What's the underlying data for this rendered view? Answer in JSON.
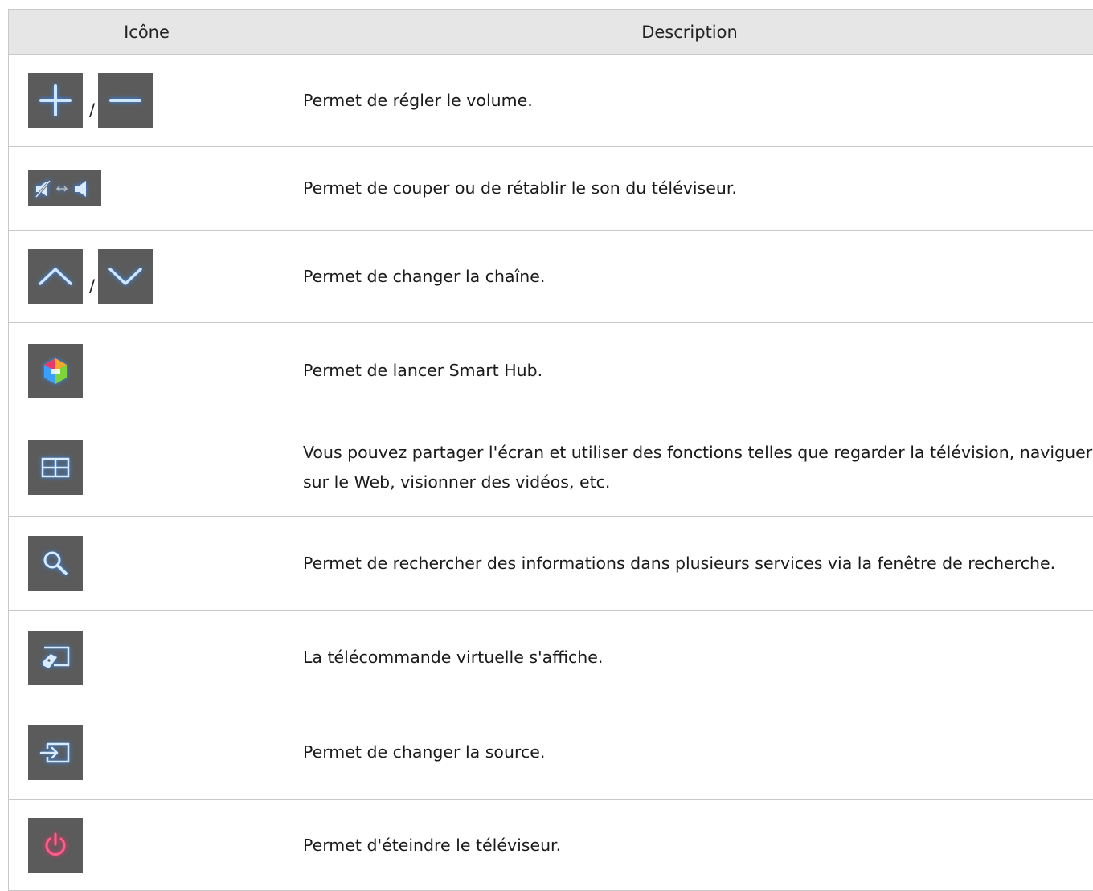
{
  "table": {
    "headers": {
      "icon": "Icône",
      "description": "Description"
    },
    "separator": "/",
    "rows": [
      {
        "icons": [
          "plus-icon",
          "minus-icon"
        ],
        "description": "Permet de régler le volume."
      },
      {
        "icons": [
          "mute-toggle-icon"
        ],
        "description": "Permet de couper ou de rétablir le son du téléviseur."
      },
      {
        "icons": [
          "chevron-up-icon",
          "chevron-down-icon"
        ],
        "description": "Permet de changer la chaîne."
      },
      {
        "icons": [
          "smart-hub-icon"
        ],
        "description": "Permet de lancer Smart Hub."
      },
      {
        "icons": [
          "multi-screen-icon"
        ],
        "description": "Vous pouvez partager l'écran et utiliser des fonctions telles que regarder la télévision, naviguer sur le Web, visionner des vidéos, etc."
      },
      {
        "icons": [
          "search-icon"
        ],
        "description": "Permet de rechercher des informations dans plusieurs services via la fenêtre de recherche."
      },
      {
        "icons": [
          "virtual-remote-icon"
        ],
        "description": "La télécommande virtuelle s'affiche."
      },
      {
        "icons": [
          "source-icon"
        ],
        "description": "Permet de changer la source."
      },
      {
        "icons": [
          "power-icon"
        ],
        "description": "Permet d'éteindre le téléviseur."
      }
    ]
  },
  "colors": {
    "icon_blue": "#2f8cff",
    "power_red": "#ff2a6a",
    "button_gray": "#5b5b5b",
    "header_bg": "#e6e6e6",
    "grid": "#c8c8c8"
  }
}
